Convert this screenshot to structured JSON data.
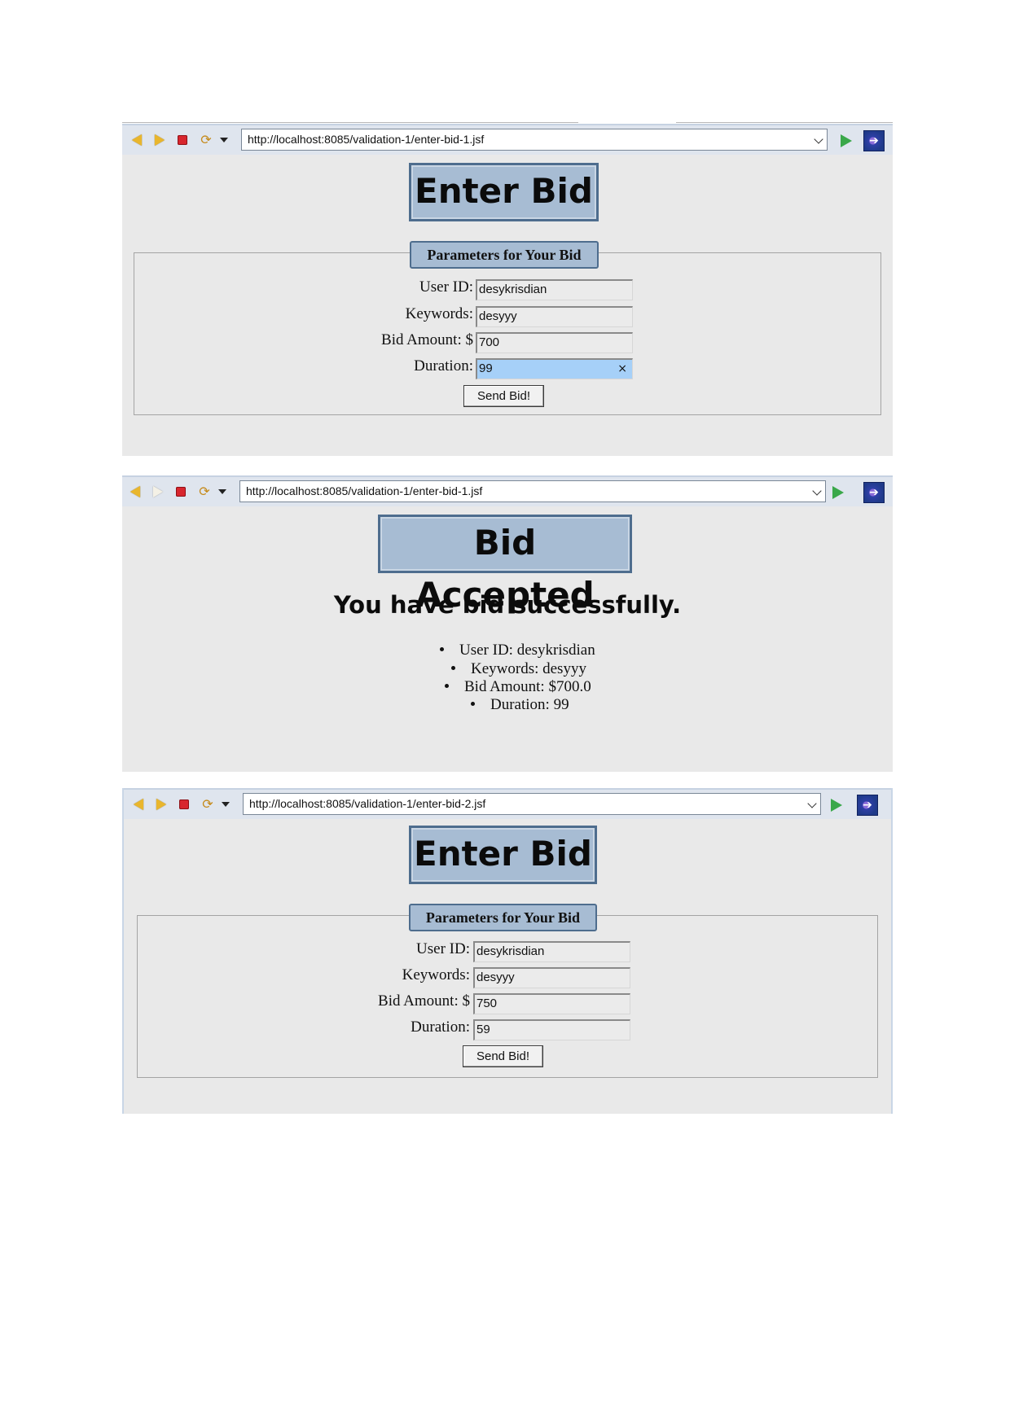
{
  "screenshots": [
    {
      "url": "http://localhost:8085/validation-1/enter-bid-1.jsf",
      "heading": "Enter Bid",
      "legend": "Parameters for Your Bid",
      "fields": [
        {
          "label": "User ID:",
          "value": "desykrisdian"
        },
        {
          "label": "Keywords:",
          "value": "desyyy"
        },
        {
          "label": "Bid Amount: $",
          "value": "700"
        },
        {
          "label": "Duration:",
          "value": "99"
        }
      ],
      "clear_icon": "×",
      "submit_label": "Send Bid!"
    },
    {
      "url": "http://localhost:8085/validation-1/enter-bid-1.jsf",
      "heading": "Bid Accepted",
      "message": "You have bid successfully.",
      "summary": [
        "User ID: desykrisdian",
        "Keywords: desyyy",
        "Bid Amount: $700.0",
        "Duration: 99"
      ]
    },
    {
      "url": "http://localhost:8085/validation-1/enter-bid-2.jsf",
      "heading": "Enter Bid",
      "legend": "Parameters for Your Bid",
      "fields": [
        {
          "label": "User ID:",
          "value": "desykrisdian"
        },
        {
          "label": "Keywords:",
          "value": "desyyy"
        },
        {
          "label": "Bid Amount: $",
          "value": "750"
        },
        {
          "label": "Duration:",
          "value": "59"
        }
      ],
      "submit_label": "Send Bid!"
    }
  ],
  "toolbar_icons": [
    "back-arrow-icon",
    "forward-arrow-icon",
    "stop-icon",
    "refresh-icon",
    "dropdown-caret-icon",
    "go-icon",
    "eclipse-icon"
  ],
  "colors": {
    "page_background": "#e9e9e9",
    "heading_box": "#a7bcd3",
    "heading_border": "#4e6d8e",
    "focused_input": "#a6d0f8",
    "go_icon": "#3aa84a"
  }
}
